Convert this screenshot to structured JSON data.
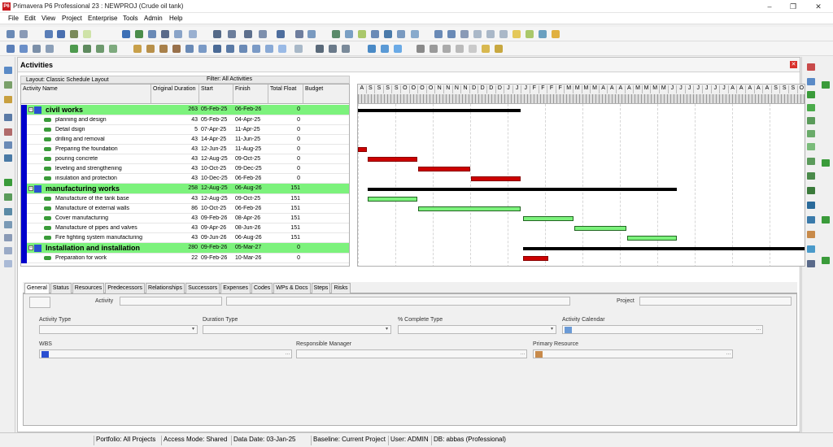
{
  "app": {
    "title": "Primavera P6 Professional 23 : NEWPROJ (Crude oil tank)",
    "icon_text": "P6"
  },
  "menu": [
    "File",
    "Edit",
    "View",
    "Project",
    "Enterprise",
    "Tools",
    "Admin",
    "Help"
  ],
  "panel": {
    "title": "Activities",
    "layout": "Layout: Classic Schedule Layout",
    "filter": "Filter: All Activities"
  },
  "columns": {
    "name": "Activity Name",
    "duration": "Original Duration",
    "start": "Start",
    "finish": "Finish",
    "float": "Total Float",
    "budget": "Budget"
  },
  "timescale": [
    "A",
    "S",
    "S",
    "S",
    "S",
    "O",
    "O",
    "O",
    "O",
    "N",
    "N",
    "N",
    "N",
    "D",
    "D",
    "D",
    "D",
    "J",
    "J",
    "J",
    "F",
    "F",
    "F",
    "F",
    "M",
    "M",
    "M",
    "M",
    "A",
    "A",
    "A",
    "A",
    "M",
    "M",
    "M",
    "M",
    "J",
    "J",
    "J",
    "J",
    "J",
    "J",
    "J",
    "A",
    "A",
    "A",
    "A",
    "A",
    "S",
    "S",
    "S",
    "O"
  ],
  "rows": [
    {
      "type": "wbs",
      "name": "civil works",
      "duration": "263",
      "start": "05-Feb-25",
      "finish": "06-Feb-26",
      "float": "0"
    },
    {
      "type": "act",
      "name": "planning and design",
      "duration": "43",
      "start": "05-Feb-25",
      "finish": "04-Apr-25",
      "float": "0"
    },
    {
      "type": "act",
      "name": "Detail dsign",
      "duration": "5",
      "start": "07-Apr-25",
      "finish": "11-Apr-25",
      "float": "0"
    },
    {
      "type": "act",
      "name": "drilling and removal",
      "duration": "43",
      "start": "14-Apr-25",
      "finish": "11-Jun-25",
      "float": "0"
    },
    {
      "type": "act",
      "name": "Preparing the foundation",
      "duration": "43",
      "start": "12-Jun-25",
      "finish": "11-Aug-25",
      "float": "0"
    },
    {
      "type": "act",
      "name": "pouring concrete",
      "duration": "43",
      "start": "12-Aug-25",
      "finish": "09-Oct-25",
      "float": "0"
    },
    {
      "type": "act",
      "name": "leveling and strengthening",
      "duration": "43",
      "start": "10-Oct-25",
      "finish": "09-Dec-25",
      "float": "0"
    },
    {
      "type": "act",
      "name": "insulation and protection",
      "duration": "43",
      "start": "10-Dec-25",
      "finish": "06-Feb-26",
      "float": "0"
    },
    {
      "type": "wbs",
      "name": "manufacturing works",
      "duration": "258",
      "start": "12-Aug-25",
      "finish": "06-Aug-26",
      "float": "151"
    },
    {
      "type": "act",
      "name": "Manufacture of the tank base",
      "duration": "43",
      "start": "12-Aug-25",
      "finish": "09-Oct-25",
      "float": "151"
    },
    {
      "type": "act",
      "name": "Manufacture of external walls",
      "duration": "86",
      "start": "10-Oct-25",
      "finish": "06-Feb-26",
      "float": "151"
    },
    {
      "type": "act",
      "name": "Cover manufacturing",
      "duration": "43",
      "start": "09-Feb-26",
      "finish": "08-Apr-26",
      "float": "151"
    },
    {
      "type": "act",
      "name": "Manufacture of pipes and valves",
      "duration": "43",
      "start": "09-Apr-26",
      "finish": "08-Jun-26",
      "float": "151"
    },
    {
      "type": "act",
      "name": "Fire fighting system manufacturing",
      "duration": "43",
      "start": "09-Jun-26",
      "finish": "06-Aug-26",
      "float": "151"
    },
    {
      "type": "wbs",
      "name": "Installation and installation",
      "duration": "280",
      "start": "09-Feb-26",
      "finish": "05-Mar-27",
      "float": "0"
    },
    {
      "type": "act",
      "name": "Preparation for work",
      "duration": "22",
      "start": "09-Feb-26",
      "finish": "10-Mar-26",
      "float": "0"
    }
  ],
  "gantt": {
    "critical_color": "#cc0000",
    "normal_color": "#7cf27c",
    "wbs_color": "#7cf27c",
    "scale_start": "2025-08-01",
    "days_shown": 520
  },
  "tabs": [
    "General",
    "Status",
    "Resources",
    "Predecessors",
    "Relationships",
    "Successors",
    "Expenses",
    "Codes",
    "WPs & Docs",
    "Steps",
    "Risks"
  ],
  "details": {
    "activity_label": "Activity",
    "project_label": "Project",
    "activity_type_label": "Activity Type",
    "duration_type_label": "Duration Type",
    "complete_type_label": "% Complete Type",
    "calendar_label": "Activity Calendar",
    "wbs_label": "WBS",
    "manager_label": "Responsible Manager",
    "resource_label": "Primary Resource"
  },
  "status": {
    "portfolio": "Portfolio: All Projects",
    "access": "Access Mode: Shared",
    "data_date": "Data Date: 03-Jan-25",
    "baseline": "Baseline: Current Project",
    "user": "User: ADMIN",
    "db": "DB: abbas (Professional)"
  }
}
